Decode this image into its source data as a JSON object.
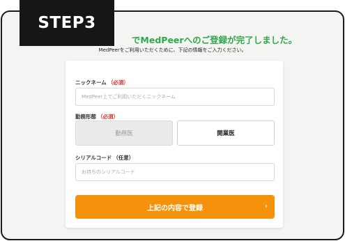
{
  "badge": {
    "label": "STEP3"
  },
  "header": {
    "title": "でMedPeerへのご登録が完了しました。",
    "subtitle": "MedPeerをご利用いただくために、下記の情報をご入力ください。"
  },
  "form": {
    "nickname": {
      "label": "ニックネーム",
      "required_mark": "（必須）",
      "placeholder": "MedPeer上でご利用いただくニックネーム"
    },
    "work_type": {
      "label": "勤務形態",
      "required_mark": "（必須）",
      "options": [
        "勤務医",
        "開業医"
      ],
      "selected": "開業医"
    },
    "serial_code": {
      "label": "シリアルコード",
      "optional_mark": "（任意）",
      "placeholder": "お持ちのシリアルコード"
    },
    "submit": {
      "label": "上記の内容で登録",
      "icon": "chevron-right-icon"
    }
  },
  "colors": {
    "accent_green": "#2ea84a",
    "button_orange": "#f5920b",
    "required_red": "#d0342c",
    "badge_bg": "#161616"
  }
}
